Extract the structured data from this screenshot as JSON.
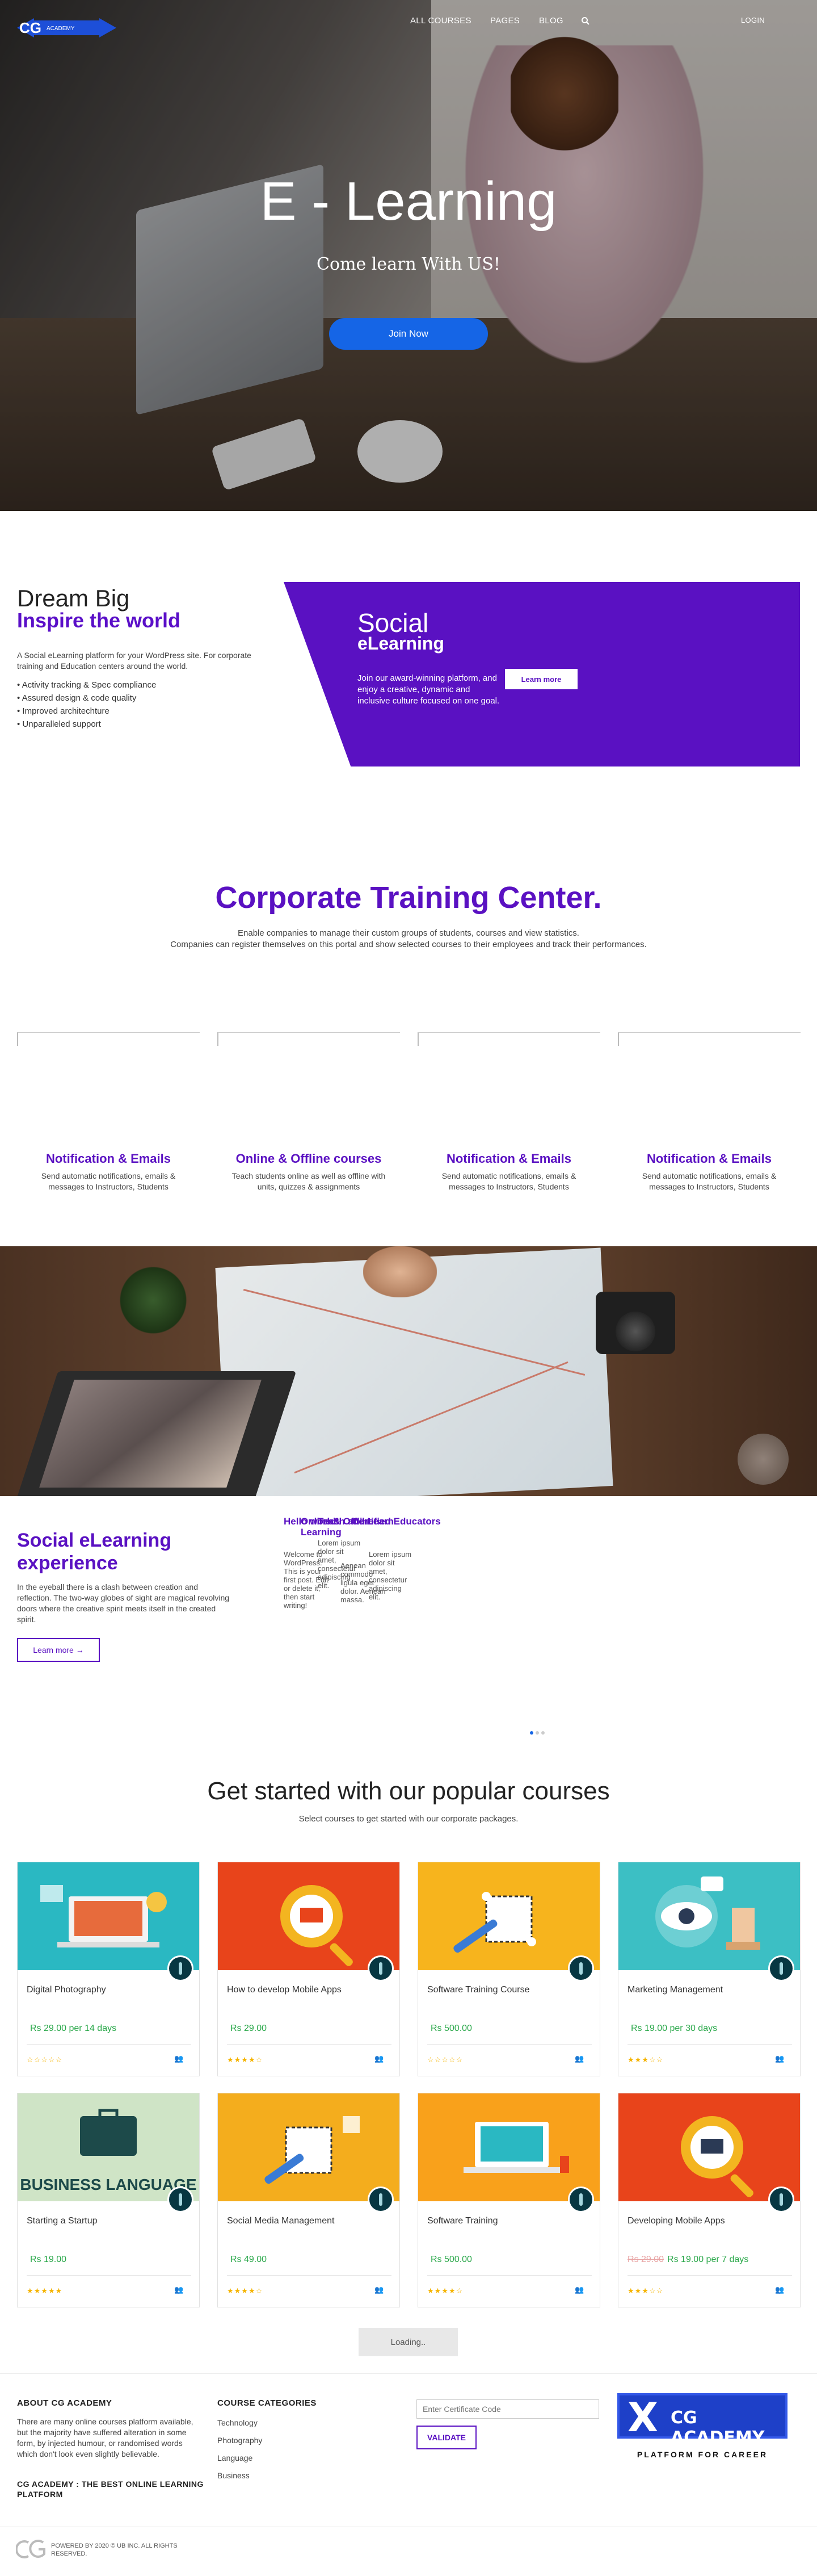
{
  "header": {
    "logo_text": "CG",
    "logo_sub": "ACADEMY",
    "nav": [
      "ALL COURSES",
      "PAGES",
      "BLOG"
    ],
    "login": "LOGIN"
  },
  "hero": {
    "title": "E - Learning",
    "subtitle": "Come learn With US!",
    "cta": "Join Now"
  },
  "dream": {
    "title": "Dream Big",
    "subtitle": "Inspire the world",
    "intro": "A Social eLearning platform for your WordPress site. For corporate training and Education centers around the world.",
    "bullets": [
      "Activity tracking & Spec compliance",
      "Assured design & code quality",
      "Improved architechture",
      "Unparalleled support"
    ]
  },
  "social": {
    "title1": "Social",
    "title2": "eLearning",
    "text": "Join our award-winning platform, and enjoy a creative, dynamic and inclusive culture focused on one goal.",
    "cta": "Learn more"
  },
  "corporate": {
    "title": "Corporate Training Center.",
    "line1": "Enable companies to manage their custom groups of students, courses and view statistics.",
    "line2": "Companies can register themselves on this portal and show selected courses to their employees and track their performances."
  },
  "features": [
    {
      "title": "Notification & Emails",
      "text": "Send automatic notifications, emails & messages to Instructors, Students"
    },
    {
      "title": "Online & Offline courses",
      "text": "Teach students online as well as offline with units, quizzes & assignments"
    },
    {
      "title": "Notification & Emails",
      "text": "Send automatic notifications, emails & messages to Instructors, Students"
    },
    {
      "title": "Notification & Emails",
      "text": "Send automatic notifications, emails & messages to Instructors, Students"
    }
  ],
  "experience": {
    "title": "Social eLearning experience",
    "text": "In the eyeball there is a clash between creation and reflection. The two-way globes of sight are magical revolving doors where the creative spirit meets itself in the created spirit.",
    "cta": "Learn more →"
  },
  "jumble": {
    "h1": "Hello world!",
    "h2": "Online & Offline Learning",
    "h3": "Teach and Learn",
    "h4": "Certified Educators",
    "b1": "Welcome to WordPress. This is your first post. Edit or delete it, then start writing!",
    "b2": "Lorem ipsum dolor sit amet, consectetur adipiscing elit.",
    "b3": "Aenean commodo ligula eget dolor. Aenean massa.",
    "b4": "Lorem ipsum dolor sit amet, consectetur adipiscing elit."
  },
  "popular": {
    "title": "Get started with our popular courses",
    "subtitle": "Select courses to get started with our corporate packages."
  },
  "courses": [
    {
      "name": "Digital Photography",
      "price": "Rs 29.00",
      "old_price": "",
      "period": " per 14 days",
      "stars": "☆☆☆☆☆",
      "students": "",
      "bg": "#2ab8c2"
    },
    {
      "name": "How to develop Mobile Apps",
      "price": "Rs 29.00",
      "old_price": "",
      "period": "",
      "stars": "★★★★☆",
      "students": "",
      "bg": "#e8441b"
    },
    {
      "name": "Software Training Course",
      "price": "Rs 500.00",
      "old_price": "",
      "period": "",
      "stars": "☆☆☆☆☆",
      "students": "",
      "bg": "#f7b41d"
    },
    {
      "name": "Marketing Management",
      "price": "Rs 19.00",
      "old_price": "",
      "period": " per 30 days",
      "stars": "★★★☆☆",
      "students": "",
      "bg": "#3cbfc4"
    },
    {
      "name": "Starting a Startup",
      "price": "Rs 19.00",
      "old_price": "",
      "period": "",
      "stars": "★★★★★",
      "students": "",
      "bg": "#cfe4c6"
    },
    {
      "name": "Social Media Management",
      "price": "Rs 49.00",
      "old_price": "",
      "period": "",
      "stars": "★★★★☆",
      "students": "",
      "bg": "#f4ad1d"
    },
    {
      "name": "Software Training",
      "price": "Rs 500.00",
      "old_price": "",
      "period": "",
      "stars": "★★★★☆",
      "students": "",
      "bg": "#f9a11b"
    },
    {
      "name": "Developing Mobile Apps",
      "price": "Rs 19.00",
      "old_price": "Rs 29.00",
      "period": " per 7 days",
      "stars": "★★★☆☆",
      "students": "",
      "bg": "#e8441b"
    }
  ],
  "course_banner": "BUSINESS LANGUAGE",
  "loading": "Loading..",
  "footer": {
    "about_title": "ABOUT CG ACADEMY",
    "about_text": "There are many online courses platform available, but the majority have suffered alteration in some form, by injected humour, or randomised words which don't look even slightly believable.",
    "about_tag": "CG ACADEMY : THE BEST ONLINE LEARNING PLATFORM",
    "cat_title": "COURSE CATEGORIES",
    "categories": [
      "Technology",
      "Photography",
      "Language",
      "Business"
    ],
    "cert_placeholder": "Enter Certificate Code",
    "validate": "VALIDATE",
    "brand_x": "X",
    "brand_name": "CG ACADEMY",
    "brand_tag": "PLATFORM FOR CAREER",
    "copyright": "POWERED BY 2020 © UB INC. ALL RIGHTS RESERVED."
  },
  "colors": {
    "accent": "#5a11c2",
    "blue": "#1565e6",
    "green": "#2aa84a"
  }
}
